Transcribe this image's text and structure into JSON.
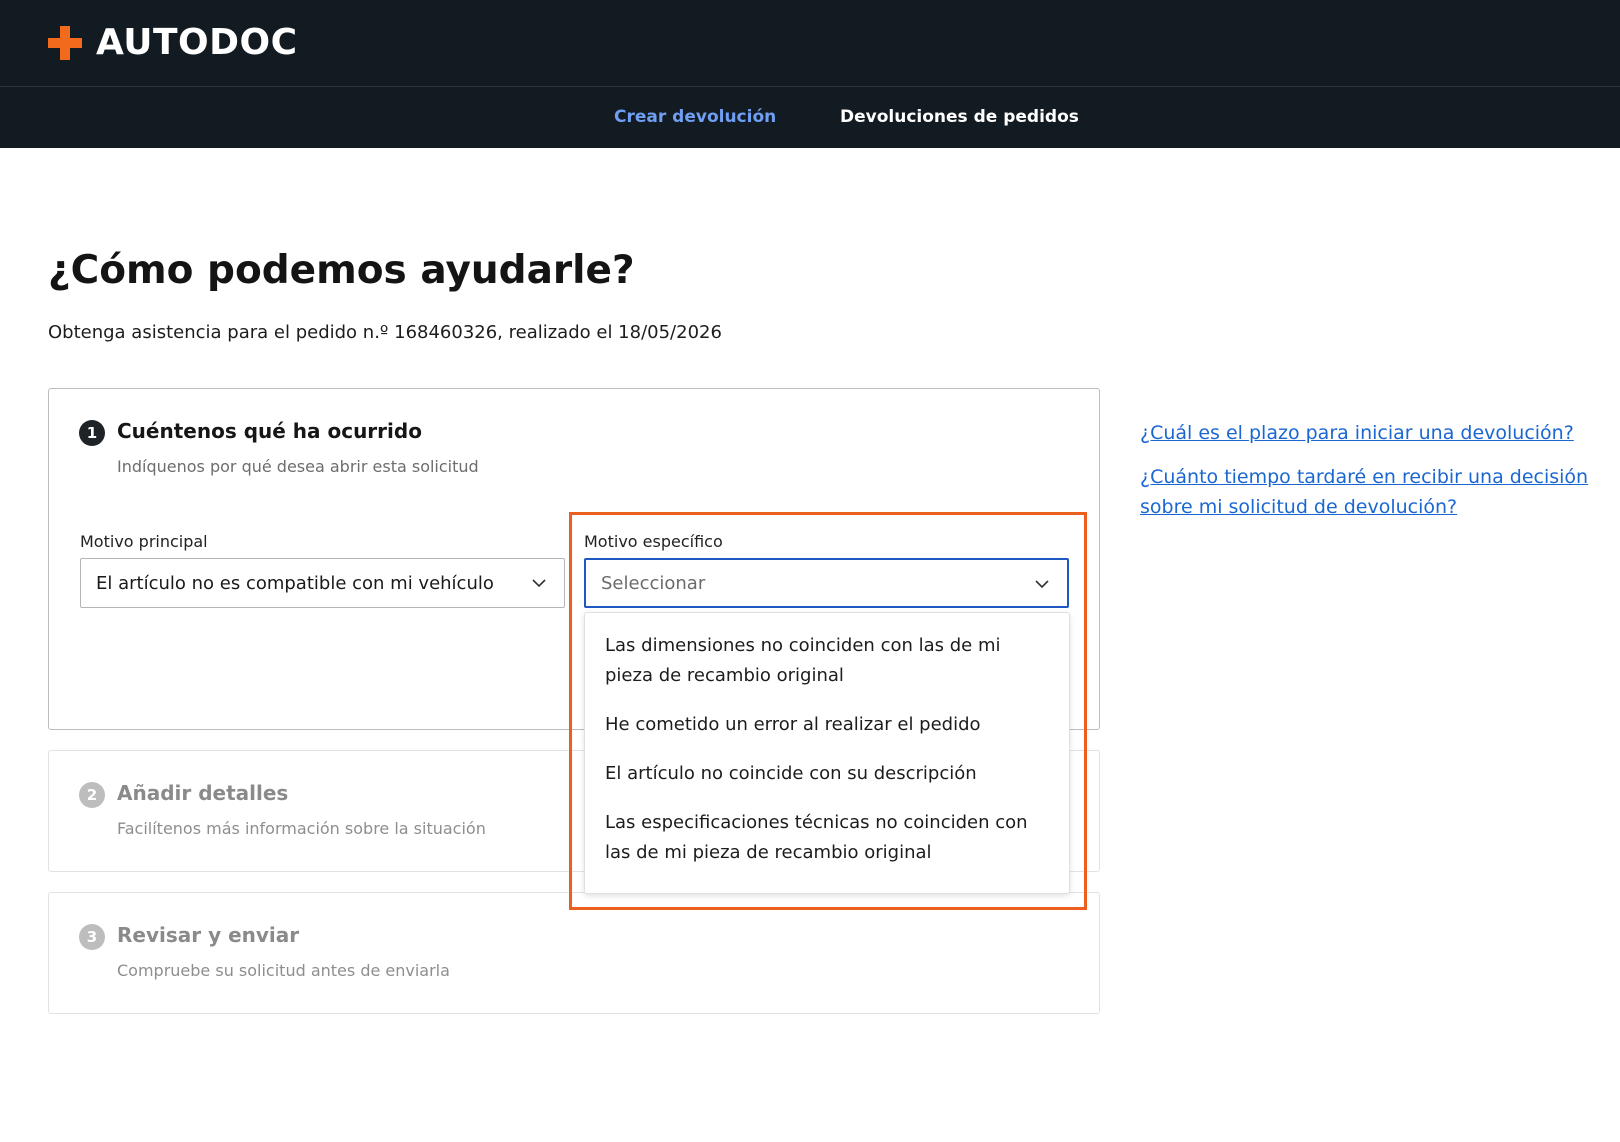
{
  "brand": {
    "name": "AUTODOC",
    "accent": "#f26a1b"
  },
  "nav": {
    "tabs": [
      {
        "label": "Crear devolución",
        "active": true
      },
      {
        "label": "Devoluciones de pedidos",
        "active": false
      }
    ]
  },
  "page": {
    "title": "¿Cómo podemos ayudarle?",
    "subtitle": "Obtenga asistencia para el pedido n.º 168460326, realizado el 18/05/2026"
  },
  "steps": [
    {
      "number": "1",
      "title": "Cuéntenos qué ha ocurrido",
      "description": "Indíquenos por qué desea abrir esta solicitud"
    },
    {
      "number": "2",
      "title": "Añadir detalles",
      "description": "Facilítenos más información sobre la situación"
    },
    {
      "number": "3",
      "title": "Revisar y enviar",
      "description": "Compruebe su solicitud antes de enviarla"
    }
  ],
  "form": {
    "main_reason": {
      "label": "Motivo principal",
      "value": "El artículo no es compatible con mi vehículo"
    },
    "specific_reason": {
      "label": "Motivo específico",
      "placeholder": "Seleccionar",
      "options": [
        "Las dimensiones no coinciden con las de mi pieza de recambio original",
        "He cometido un error al realizar el pedido",
        "El artículo no coincide con su descripción",
        "Las especificaciones técnicas no coinciden con las de mi pieza de recambio original"
      ]
    }
  },
  "faq": [
    "¿Cuál es el plazo para iniciar una devolución?",
    "¿Cuánto tiempo tardaré en recibir una decisión sobre mi solicitud de devolución?"
  ],
  "colors": {
    "header_bg": "#131b22",
    "active_tab": "#6f9ef2",
    "link": "#1a67d2",
    "focus": "#1f57c3",
    "highlight": "#ec5f1f"
  },
  "icons": {
    "logo": "plus-logo-icon",
    "select_arrow": "chevron-down-icon"
  }
}
